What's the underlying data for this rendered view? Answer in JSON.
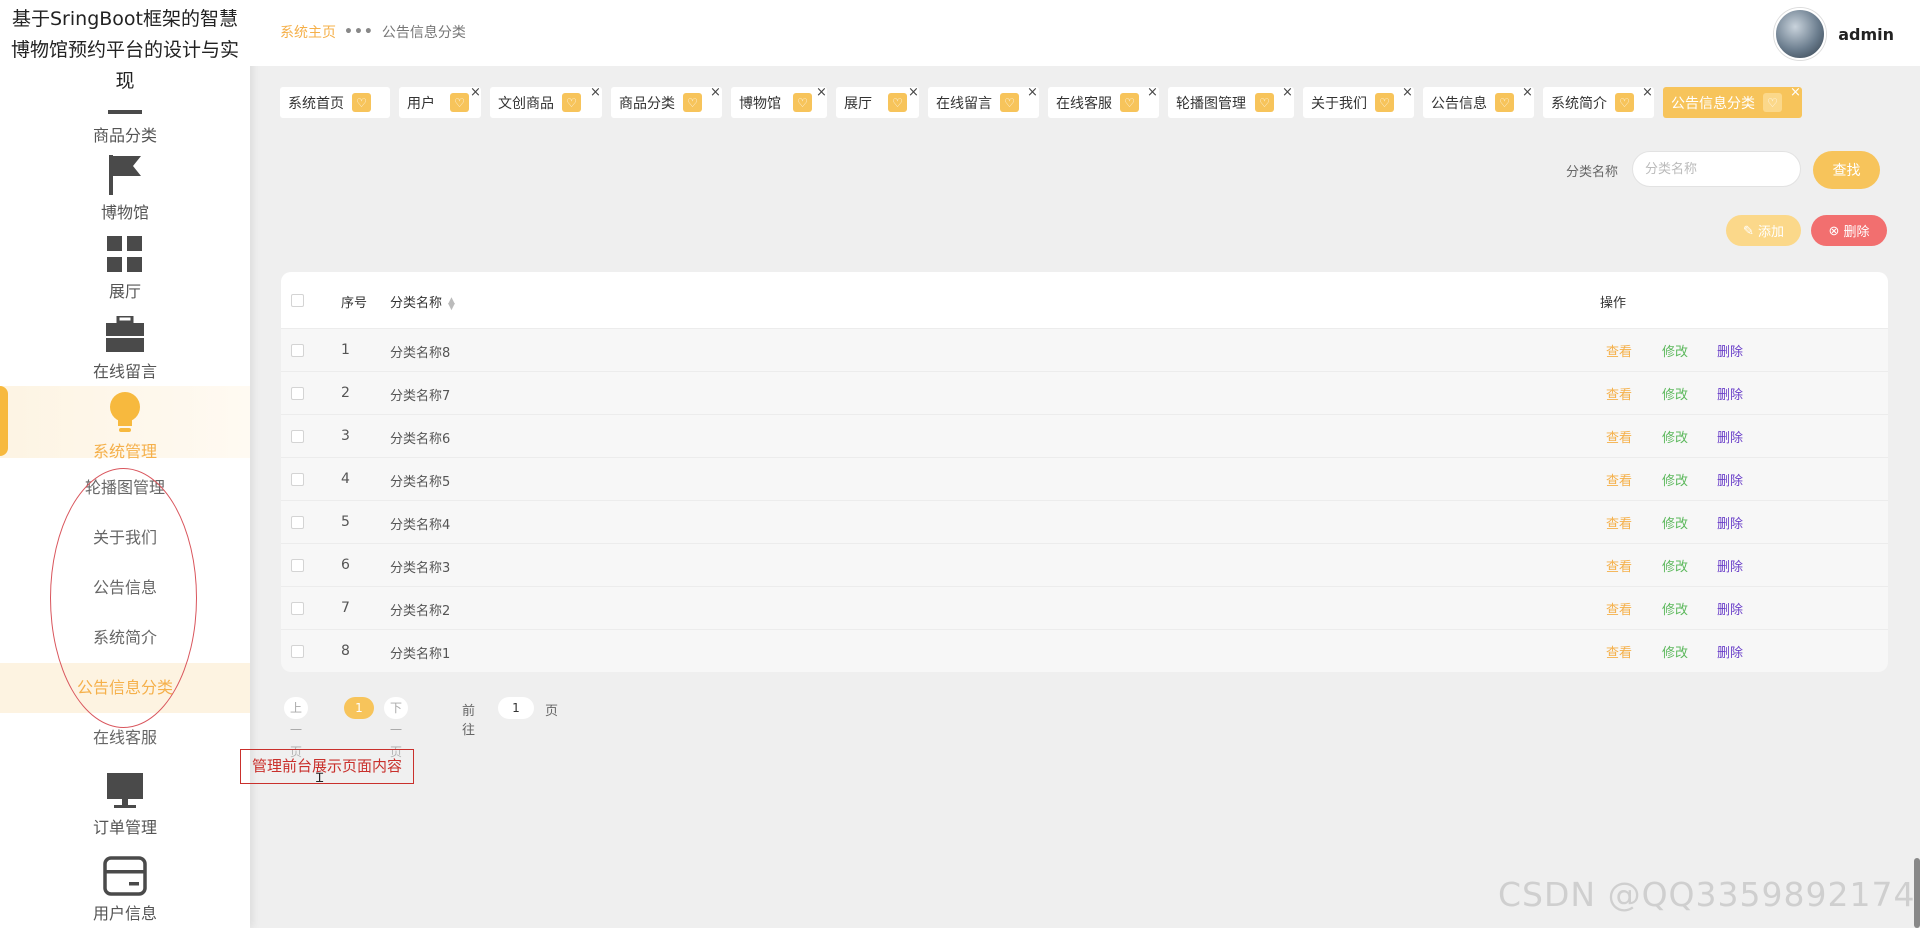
{
  "sidebar": {
    "brand": "基于SringBoot框架的智慧博物馆预约平台的设计与实现",
    "menu": [
      {
        "label": "商品分类",
        "icon": "dash-icon"
      },
      {
        "label": "博物馆",
        "icon": "flag-icon"
      },
      {
        "label": "展厅",
        "icon": "grid-icon"
      },
      {
        "label": "在线留言",
        "icon": "briefcase-icon"
      },
      {
        "label": "系统管理",
        "icon": "bulb-icon",
        "active": true
      }
    ],
    "submenu": [
      {
        "label": "轮播图管理"
      },
      {
        "label": "关于我们"
      },
      {
        "label": "公告信息"
      },
      {
        "label": "系统简介"
      },
      {
        "label": "公告信息分类",
        "active": true
      },
      {
        "label": "在线客服"
      }
    ],
    "menu_bottom": [
      {
        "label": "订单管理",
        "icon": "monitor-icon"
      },
      {
        "label": "用户信息",
        "icon": "card-icon"
      }
    ]
  },
  "header": {
    "breadcrumb_home": "系统主页",
    "breadcrumb_sep": "•••",
    "breadcrumb_current": "公告信息分类",
    "username": "admin"
  },
  "tabs": [
    {
      "label": "系统首页"
    },
    {
      "label": "用户"
    },
    {
      "label": "文创商品"
    },
    {
      "label": "商品分类"
    },
    {
      "label": "博物馆"
    },
    {
      "label": "展厅"
    },
    {
      "label": "在线留言"
    },
    {
      "label": "在线客服"
    },
    {
      "label": "轮播图管理"
    },
    {
      "label": "关于我们"
    },
    {
      "label": "公告信息"
    },
    {
      "label": "系统简介"
    },
    {
      "label": "公告信息分类",
      "active": true
    }
  ],
  "search": {
    "label": "分类名称",
    "placeholder": "分类名称",
    "button": "查找"
  },
  "actions": {
    "add": "添加",
    "delete": "删除"
  },
  "table": {
    "columns": {
      "index": "序号",
      "name": "分类名称",
      "ops": "操作"
    },
    "op_labels": {
      "view": "查看",
      "edit": "修改",
      "delete": "删除"
    },
    "rows": [
      {
        "index": "1",
        "name": "分类名称8"
      },
      {
        "index": "2",
        "name": "分类名称7"
      },
      {
        "index": "3",
        "name": "分类名称6"
      },
      {
        "index": "4",
        "name": "分类名称5"
      },
      {
        "index": "5",
        "name": "分类名称4"
      },
      {
        "index": "6",
        "name": "分类名称3"
      },
      {
        "index": "7",
        "name": "分类名称2"
      },
      {
        "index": "8",
        "name": "分类名称1"
      }
    ]
  },
  "pager": {
    "prev": "上一页",
    "current": "1",
    "next": "下一页",
    "goto_label": "前往",
    "goto_value": "1",
    "unit": "页"
  },
  "annotation": "管理前台展示页面内容",
  "watermark": "CSDN @QQ3359892174",
  "colors": {
    "accent": "#f7c45b",
    "accent_text": "#f5b04a",
    "danger": "#f26f6f",
    "edit": "#5cb85c",
    "delete_link": "#6a3fc9",
    "annotation": "#c9302c"
  }
}
